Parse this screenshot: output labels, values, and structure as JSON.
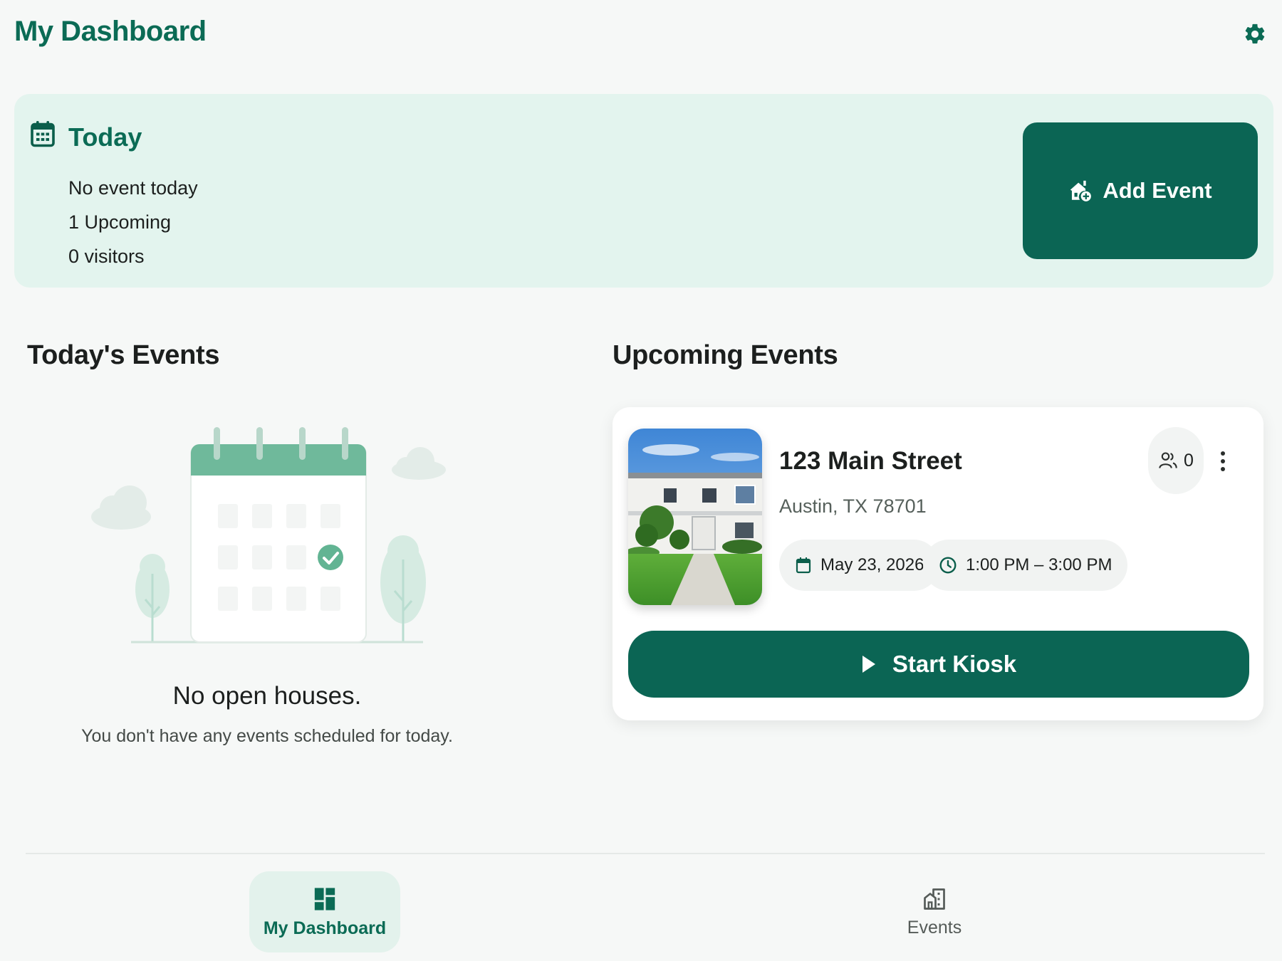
{
  "header": {
    "title": "My Dashboard",
    "settings_icon": "gear-icon"
  },
  "today": {
    "title": "Today",
    "icon": "calendar-icon",
    "stats": [
      "No event today",
      "1 Upcoming",
      "0 visitors"
    ],
    "add_event_label": "Add Event",
    "add_event_icon": "house-add-icon"
  },
  "todays_events": {
    "heading": "Today's Events",
    "empty_title": "No open houses.",
    "empty_subtitle": "You don't have any events scheduled for today."
  },
  "upcoming_events": {
    "heading": "Upcoming Events",
    "items": [
      {
        "street": "123 Main Street",
        "city": "Austin, TX 78701",
        "visitors": "0",
        "date": "May 23, 2026",
        "time": "1:00 PM – 3:00 PM",
        "start_label": "Start Kiosk"
      }
    ]
  },
  "bottom_nav": {
    "items": [
      {
        "label": "My Dashboard",
        "icon": "dashboard-icon",
        "active": true
      },
      {
        "label": "Events",
        "icon": "building-icon",
        "active": false
      }
    ]
  },
  "colors": {
    "brand": "#0b6b55",
    "button": "#0b6554",
    "banner_bg": "#e3f4ee",
    "page_bg": "#f6f8f7"
  }
}
